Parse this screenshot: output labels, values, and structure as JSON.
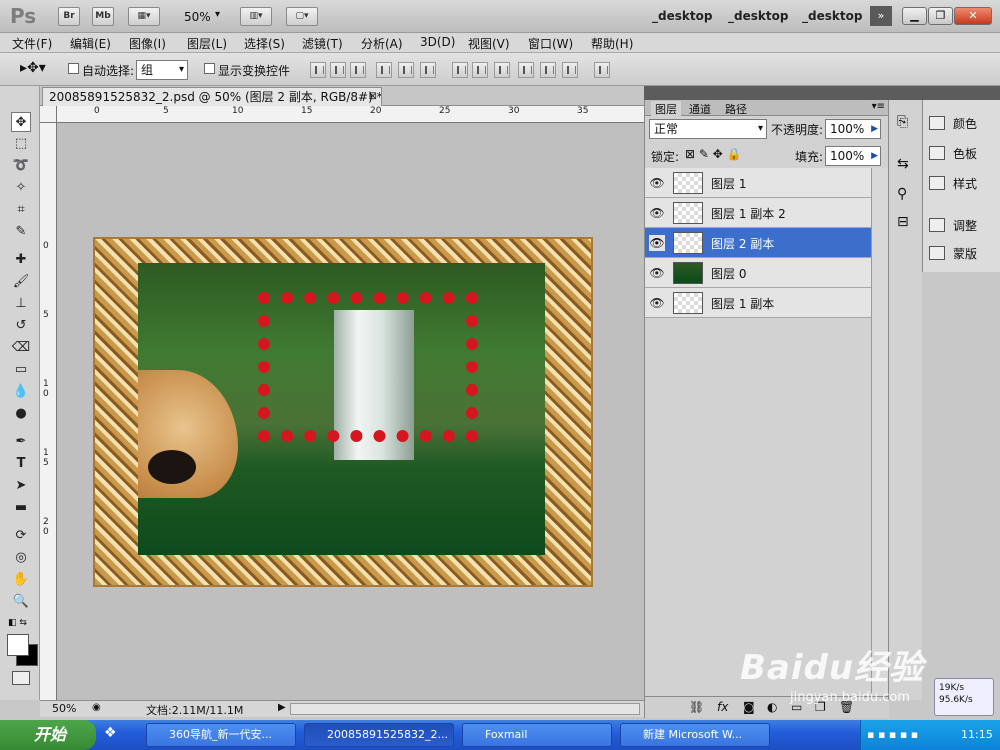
{
  "app": {
    "logo": "Ps",
    "bridge_label": "Br",
    "minibridge_label": "Mb",
    "zoom": "50%",
    "workspaces": [
      "_desktop",
      "_desktop",
      "_desktop"
    ]
  },
  "menu": [
    "文件(F)",
    "编辑(E)",
    "图像(I)",
    "图层(L)",
    "选择(S)",
    "滤镜(T)",
    "分析(A)",
    "3D(D)",
    "视图(V)",
    "窗口(W)",
    "帮助(H)"
  ],
  "options": {
    "auto_select_label": "自动选择:",
    "auto_select_value": "组",
    "show_transform_label": "显示变换控件"
  },
  "document": {
    "tab_title": "20085891525832_2.psd @ 50% (图层 2 副本, RGB/8#) *",
    "zoom": "50%",
    "doc_info": "文档:2.11M/11.1M"
  },
  "ruler": {
    "h_ticks": [
      "0",
      "5",
      "10",
      "15",
      "20",
      "25",
      "30",
      "35"
    ],
    "v_ticks": [
      "0",
      "5",
      "1 0",
      "1 5",
      "2 0"
    ]
  },
  "layers_panel": {
    "tabs": [
      "图层",
      "通道",
      "路径"
    ],
    "blend_mode": "正常",
    "opacity_label": "不透明度:",
    "opacity": "100%",
    "lock_label": "锁定:",
    "fill_label": "填充:",
    "fill": "100%",
    "layers": [
      {
        "name": "图层 1",
        "active": false
      },
      {
        "name": "图层 1 副本 2",
        "active": false
      },
      {
        "name": "图层 2 副本",
        "active": true
      },
      {
        "name": "图层 0",
        "active": false
      },
      {
        "name": "图层 1 副本",
        "active": false
      }
    ]
  },
  "right_panel": {
    "items": [
      "颜色",
      "色板",
      "样式",
      "调整",
      "蒙版"
    ]
  },
  "taskbar": {
    "start_label": "开始",
    "buttons": [
      "360导航_新一代安...",
      "20085891525832_2...",
      "Foxmail",
      "新建 Microsoft W..."
    ],
    "clock": "11:15",
    "net_up": "19K/s",
    "net_down": "95.6K/s"
  },
  "watermark": {
    "text": "Baidu经验",
    "sub": "jingyan.baidu.com"
  }
}
